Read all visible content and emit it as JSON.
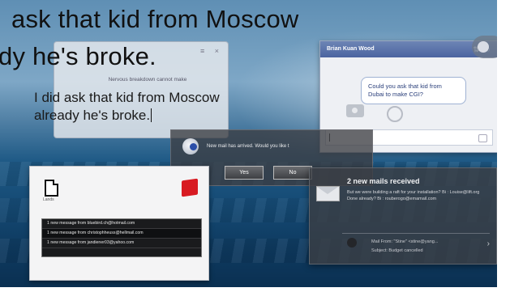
{
  "headline": {
    "line1": "ask that kid from Moscow",
    "line2": "dy he's broke."
  },
  "error_popup": {
    "controls": "≡ ×",
    "message": "Nervous breakdown cannot make"
  },
  "document": {
    "line1": "I did ask that kid from Moscow",
    "line2": "already he's broke."
  },
  "chat": {
    "contact_name": "Brian Kuan Wood",
    "title_icons": "⇅ ○",
    "message": "Could you ask that kid from Dubai to make CGI?"
  },
  "mail_dialog": {
    "question": "New mail has arrived. Would you like t",
    "yes_label": "Yes",
    "no_label": "No"
  },
  "file_window": {
    "file_label": "Lands",
    "rows": [
      "1 new message from bluebird.ch@hotmail.com",
      "1 new message from christophheuss@hellmail.com",
      "1 new message from jandiener03@yahoo.com"
    ]
  },
  "notification": {
    "title": "2 new mails received",
    "body": "But we were building a raft for your installation? Bi : Louise@lift.org Done already? Bi : rouberogo@emamail.com",
    "from": "Mail From: \"Stine\" <stine@yang...",
    "subject": "Subject: Budget cancelled"
  },
  "colors": {
    "chat_title": "#4b64a0",
    "chat_bubble_text": "#2a3f7a",
    "alert_red": "#d81b22"
  }
}
